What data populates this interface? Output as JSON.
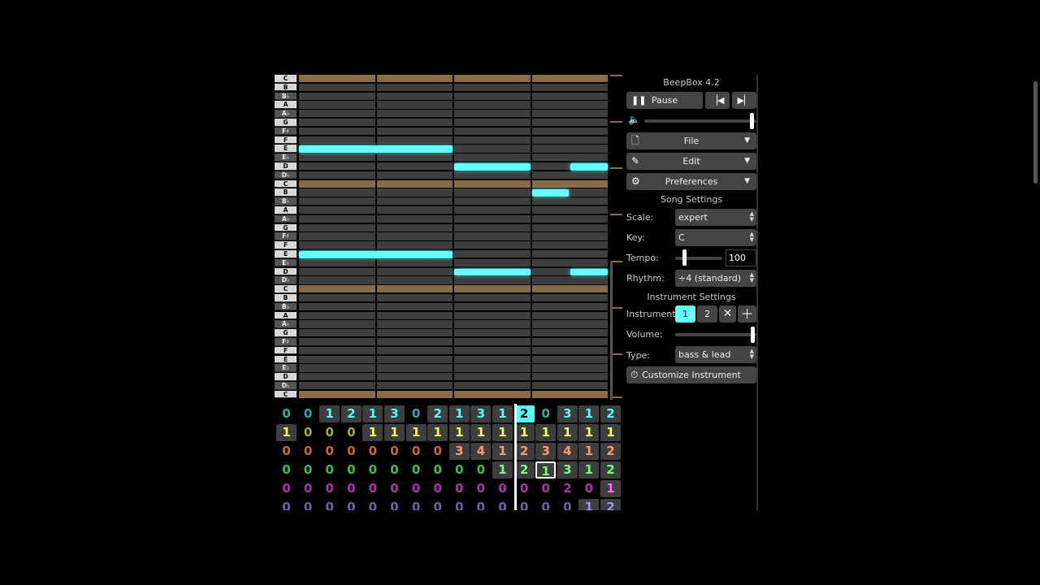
{
  "app": {
    "title": "BeepBox 4.2"
  },
  "transport": {
    "pause_label": "Pause",
    "volume_fraction": 0.98
  },
  "menus": {
    "file": "File",
    "edit": "Edit",
    "preferences": "Preferences"
  },
  "song_settings": {
    "heading": "Song Settings",
    "scale_label": "Scale:",
    "scale_value": "expert",
    "key_label": "Key:",
    "key_value": "C",
    "tempo_label": "Tempo:",
    "tempo_value": "100",
    "tempo_fraction": 0.17,
    "rhythm_label": "Rhythm:",
    "rhythm_value": "÷4 (standard)"
  },
  "instrument_settings": {
    "heading": "Instrument Settings",
    "instrument_label": "Instrument:",
    "instrument_1": "1",
    "instrument_2": "2",
    "volume_label": "Volume:",
    "volume_fraction": 0.98,
    "type_label": "Type:",
    "type_value": "bass & lead",
    "customize_label": "Customize Instrument"
  },
  "piano_keys": [
    "C",
    "B",
    "B♭",
    "A",
    "A♭",
    "G",
    "F♯",
    "F",
    "E",
    "E♭",
    "D",
    "D♭",
    "C",
    "B",
    "B♭",
    "A",
    "A♭",
    "G",
    "F♯",
    "F",
    "E",
    "E♭",
    "D",
    "D♭",
    "C",
    "B",
    "B♭",
    "A",
    "A♭",
    "G",
    "F♯",
    "F",
    "E",
    "E♭",
    "D",
    "D♭",
    "C"
  ],
  "notes": [
    {
      "key_index": 8,
      "start": 0,
      "end": 2
    },
    {
      "key_index": 10,
      "start": 2,
      "end": 3
    },
    {
      "key_index": 10,
      "start": 3.5,
      "end": 4
    },
    {
      "key_index": 13,
      "start": 3,
      "end": 3.5
    },
    {
      "key_index": 20,
      "start": 0,
      "end": 2
    },
    {
      "key_index": 22,
      "start": 2,
      "end": 3
    },
    {
      "key_index": 22,
      "start": 3.5,
      "end": 4
    }
  ],
  "pattern_rows": [
    {
      "color": "#5ff",
      "dim": "#3aa",
      "values": [
        "0",
        "0",
        "1",
        "2",
        "1",
        "3",
        "0",
        "2",
        "1",
        "3",
        "1",
        "2",
        "0",
        "3",
        "1",
        "2"
      ],
      "filled": [
        false,
        false,
        true,
        true,
        true,
        true,
        false,
        true,
        true,
        true,
        true,
        true,
        false,
        true,
        true,
        true
      ]
    },
    {
      "color": "#ff6",
      "dim": "#aa4",
      "values": [
        "1",
        "0",
        "0",
        "0",
        "1",
        "1",
        "1",
        "1",
        "1",
        "1",
        "1",
        "1",
        "1",
        "1",
        "1",
        "1"
      ],
      "filled": [
        true,
        false,
        false,
        false,
        true,
        true,
        true,
        true,
        true,
        true,
        true,
        true,
        true,
        true,
        true,
        true
      ]
    },
    {
      "color": "#f96",
      "dim": "#c63",
      "values": [
        "0",
        "0",
        "0",
        "0",
        "0",
        "0",
        "0",
        "0",
        "3",
        "4",
        "1",
        "2",
        "3",
        "4",
        "1",
        "2"
      ],
      "filled": [
        false,
        false,
        false,
        false,
        false,
        false,
        false,
        false,
        true,
        true,
        true,
        true,
        true,
        true,
        true,
        true
      ]
    },
    {
      "color": "#7f7",
      "dim": "#4b4",
      "values": [
        "0",
        "0",
        "0",
        "0",
        "0",
        "0",
        "0",
        "0",
        "0",
        "0",
        "1",
        "2",
        "1",
        "3",
        "1",
        "2"
      ],
      "filled": [
        false,
        false,
        false,
        false,
        false,
        false,
        false,
        false,
        false,
        false,
        true,
        true,
        true,
        true,
        true,
        true
      ]
    },
    {
      "color": "#f6f",
      "dim": "#a3a",
      "values": [
        "0",
        "0",
        "0",
        "0",
        "0",
        "0",
        "0",
        "0",
        "0",
        "0",
        "0",
        "0",
        "0",
        "2",
        "0",
        "1"
      ],
      "filled": [
        false,
        false,
        false,
        false,
        false,
        false,
        false,
        false,
        false,
        false,
        false,
        false,
        false,
        false,
        false,
        true
      ]
    },
    {
      "color": "#99f",
      "dim": "#66a",
      "values": [
        "0",
        "0",
        "0",
        "0",
        "0",
        "0",
        "0",
        "0",
        "0",
        "0",
        "0",
        "0",
        "0",
        "0",
        "1",
        "2"
      ],
      "filled": [
        false,
        false,
        false,
        false,
        false,
        false,
        false,
        false,
        false,
        false,
        false,
        false,
        false,
        false,
        true,
        true
      ]
    }
  ],
  "selection": {
    "current_bar": 11,
    "selected_row": 3,
    "selected_bar": 12
  },
  "colors": {
    "note": "#66ffff",
    "octave": "#8a6b48",
    "cell": "#3e3e3e",
    "button": "#444444"
  }
}
